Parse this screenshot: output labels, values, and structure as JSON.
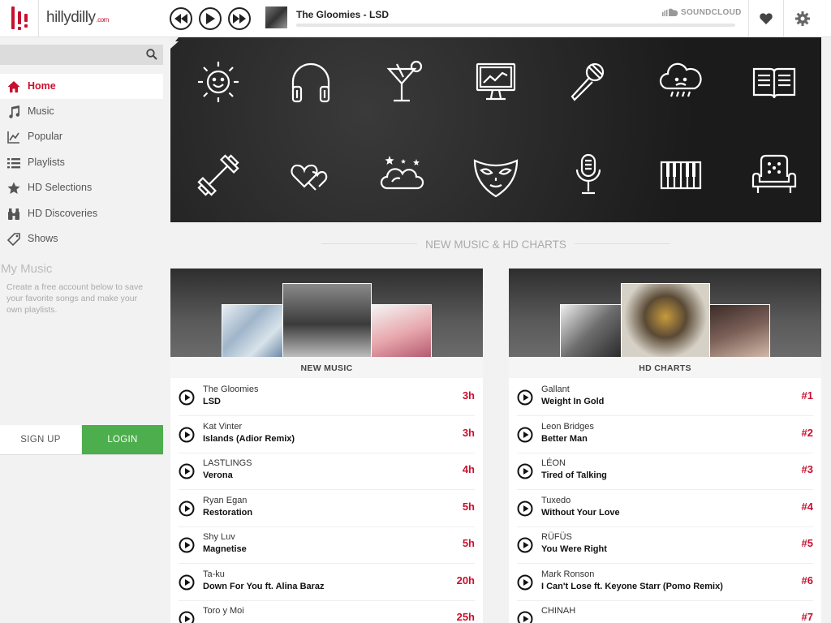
{
  "header": {
    "logo_text": "hillydilly",
    "logo_suffix": ".com",
    "track_title": "The Gloomies - LSD",
    "source": "SOUNDCLOUD"
  },
  "sidebar": {
    "search_placeholder": "",
    "nav": [
      {
        "label": "Home",
        "icon": "home-icon",
        "active": true
      },
      {
        "label": "Music",
        "icon": "music-note-icon"
      },
      {
        "label": "Popular",
        "icon": "chart-line-icon"
      },
      {
        "label": "Playlists",
        "icon": "list-icon"
      },
      {
        "label": "HD Selections",
        "icon": "star-icon"
      },
      {
        "label": "HD Discoveries",
        "icon": "binoculars-icon"
      },
      {
        "label": "Shows",
        "icon": "ticket-icon"
      }
    ],
    "my_music_title": "My Music",
    "my_music_desc": "Create a free account below to save your favorite songs and make your own playlists.",
    "signup_label": "SIGN UP",
    "login_label": "LOGIN"
  },
  "moods": [
    "sun-icon",
    "headphones-icon",
    "cocktail-icon",
    "monitor-icon",
    "microphone-icon",
    "rain-cloud-icon",
    "book-icon",
    "dumbbell-icon",
    "hearts-icon",
    "night-cloud-icon",
    "mask-icon",
    "studio-mic-icon",
    "piano-icon",
    "armchair-icon"
  ],
  "section_title": "NEW MUSIC & HD CHARTS",
  "new_music": {
    "caption": "NEW MUSIC",
    "rows": [
      {
        "artist": "The Gloomies",
        "title": "LSD",
        "age": "3h"
      },
      {
        "artist": "Kat Vinter",
        "title": "Islands (Adior Remix)",
        "age": "3h"
      },
      {
        "artist": "LASTLINGS",
        "title": "Verona",
        "age": "4h"
      },
      {
        "artist": "Ryan Egan",
        "title": "Restoration",
        "age": "5h"
      },
      {
        "artist": "Shy Luv",
        "title": "Magnetise",
        "age": "5h"
      },
      {
        "artist": "Ta-ku",
        "title": "Down For You ft. Alina Baraz",
        "age": "20h"
      },
      {
        "artist": "Toro y Moi",
        "title": "",
        "age": "25h"
      }
    ]
  },
  "hd_charts": {
    "caption": "HD CHARTS",
    "rows": [
      {
        "artist": "Gallant",
        "title": "Weight In Gold",
        "rank": "#1"
      },
      {
        "artist": "Leon Bridges",
        "title": "Better Man",
        "rank": "#2"
      },
      {
        "artist": "LÉON",
        "title": "Tired of Talking",
        "rank": "#3"
      },
      {
        "artist": "Tuxedo",
        "title": "Without Your Love",
        "rank": "#4"
      },
      {
        "artist": "RÜFÜS",
        "title": "You Were Right",
        "rank": "#5"
      },
      {
        "artist": "Mark Ronson",
        "title": "I Can't Lose ft. Keyone Starr (Pomo Remix)",
        "rank": "#6"
      },
      {
        "artist": "CHINAH",
        "title": "",
        "rank": "#7"
      }
    ]
  },
  "colors": {
    "accent": "#c8102e",
    "login": "#4cae4c"
  }
}
